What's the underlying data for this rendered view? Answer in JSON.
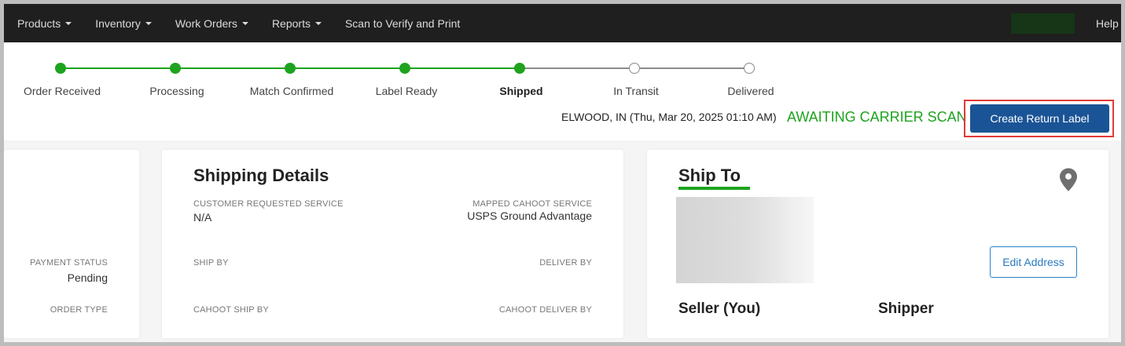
{
  "nav": {
    "items": [
      {
        "label": "Products",
        "dropdown": true
      },
      {
        "label": "Inventory",
        "dropdown": true
      },
      {
        "label": "Work Orders",
        "dropdown": true
      },
      {
        "label": "Reports",
        "dropdown": true
      },
      {
        "label": "Scan to Verify and Print",
        "dropdown": false
      }
    ],
    "help": "Help"
  },
  "progress": {
    "steps": [
      {
        "label": "Order Received",
        "done": true
      },
      {
        "label": "Processing",
        "done": true
      },
      {
        "label": "Match Confirmed",
        "done": true
      },
      {
        "label": "Label Ready",
        "done": true
      },
      {
        "label": "Shipped",
        "done": true,
        "active": true
      },
      {
        "label": "In Transit",
        "done": false
      },
      {
        "label": "Delivered",
        "done": false
      }
    ],
    "location": "ELWOOD, IN (Thu, Mar 20, 2025 01:10 AM)",
    "status": "AWAITING CARRIER SCAN",
    "return_button": "Create Return Label"
  },
  "left_card": {
    "payment_status_label": "PAYMENT STATUS",
    "payment_status_value": "Pending",
    "order_type_label": "ORDER TYPE"
  },
  "shipping": {
    "title": "Shipping Details",
    "customer_service_label": "CUSTOMER REQUESTED SERVICE",
    "customer_service_value": "N/A",
    "mapped_service_label": "MAPPED CAHOOT SERVICE",
    "mapped_service_value": "USPS Ground Advantage",
    "ship_by_label": "SHIP BY",
    "deliver_by_label": "DELIVER BY",
    "cahoot_ship_by_label": "CAHOOT SHIP BY",
    "cahoot_deliver_by_label": "CAHOOT DELIVER BY"
  },
  "ship_to": {
    "title": "Ship To",
    "edit_button": "Edit Address",
    "seller_label": "Seller (You)",
    "shipper_label": "Shipper"
  },
  "colors": {
    "accent_green": "#1ea31e",
    "primary_blue": "#1b5496",
    "highlight_red": "#e03a3a"
  }
}
